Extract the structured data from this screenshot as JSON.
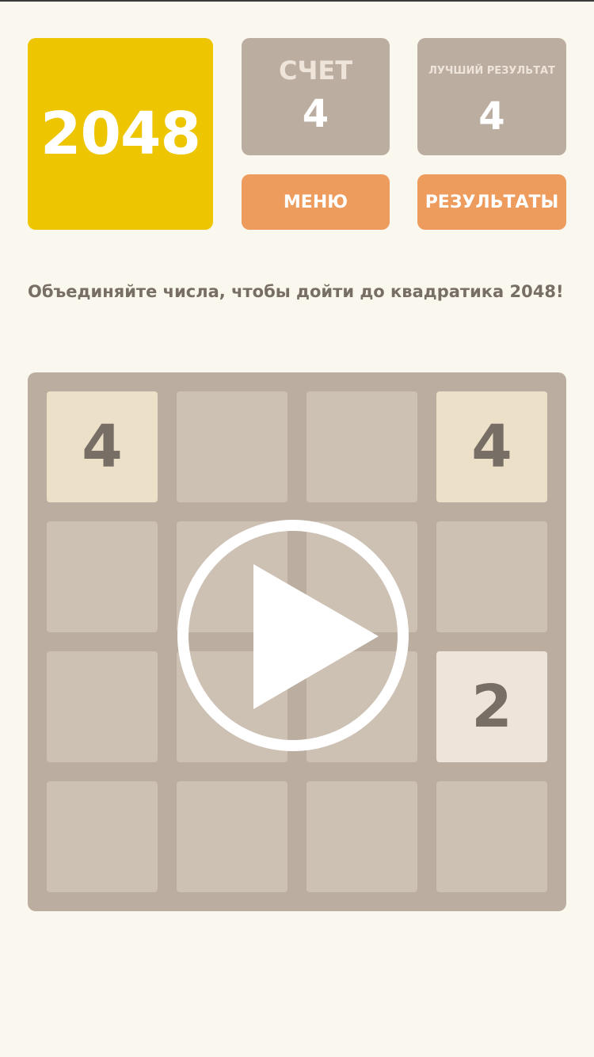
{
  "header": {
    "logo": "2048",
    "score_label": "СЧЕТ",
    "score_value": "4",
    "best_label": "ЛУЧШИЙ РЕЗУЛЬТАТ",
    "best_value": "4",
    "menu_label": "МЕНЮ",
    "results_label": "РЕЗУЛЬТАТЫ"
  },
  "intro": "Объединяйте числа, чтобы дойти до квадратика 2048!",
  "board": {
    "size": 4,
    "tiles": [
      {
        "row": 0,
        "col": 0,
        "value": "4",
        "color": "#ede0c8"
      },
      {
        "row": 0,
        "col": 3,
        "value": "4",
        "color": "#ede0c8"
      },
      {
        "row": 2,
        "col": 3,
        "value": "2",
        "color": "#eee4da"
      }
    ]
  },
  "overlay": {
    "icon": "play-icon"
  },
  "colors": {
    "background": "#faf7ee",
    "logo": "#edc500",
    "box": "#bbada0",
    "button": "#ee9b5e",
    "board": "#bbada0",
    "empty_cell": "#cdc1b4",
    "tile_text": "#776e65"
  }
}
